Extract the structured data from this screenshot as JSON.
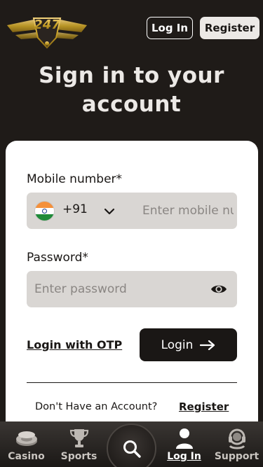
{
  "header": {
    "logo_text": "247 GAMES",
    "login_label": "Log In",
    "register_label": "Register"
  },
  "page_title": "Sign in to your account",
  "form": {
    "mobile_label": "Mobile number*",
    "dial_code": "+91",
    "country_flag": "india-flag-icon",
    "mobile_placeholder": "Enter mobile number",
    "mobile_value": "",
    "password_label": "Password*",
    "password_placeholder": "Enter password",
    "password_value": "",
    "otp_link": "Login with OTP",
    "login_button": "Login",
    "no_account_text": "Don't Have an Account?",
    "register_link": "Register"
  },
  "bottom_nav": {
    "items": [
      {
        "label": "Casino",
        "icon": "casino-chip-icon",
        "active": false
      },
      {
        "label": "Sports",
        "icon": "trophy-icon",
        "active": false
      },
      {
        "label": "",
        "icon": "search-icon",
        "active": false
      },
      {
        "label": "Log In",
        "icon": "user-icon",
        "active": true
      },
      {
        "label": "Support",
        "icon": "headset-icon",
        "active": false
      }
    ]
  },
  "colors": {
    "background": "#1f1b18",
    "card": "#ffffff",
    "field": "#d9d6d3",
    "primary_button": "#1a1715",
    "logo_gold": "#c9a227"
  }
}
